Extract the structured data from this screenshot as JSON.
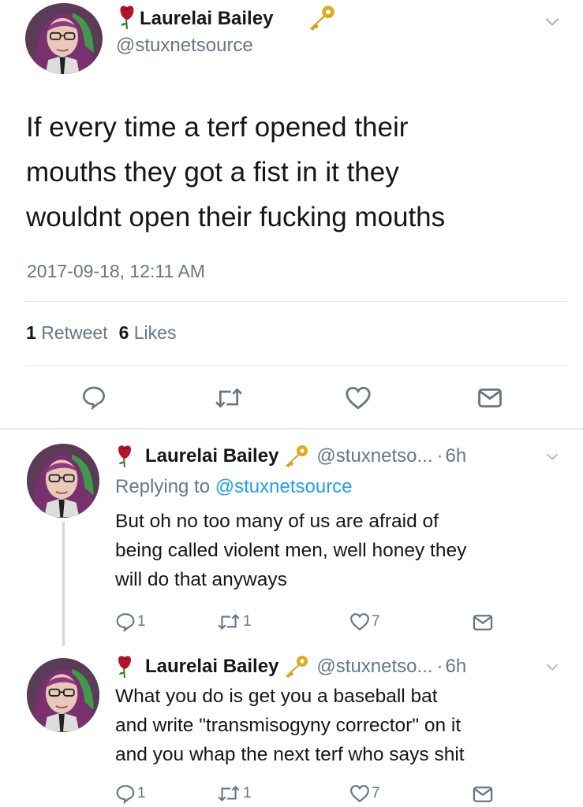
{
  "main_tweet": {
    "display_name": "Laurelai Bailey",
    "handle": "@stuxnetsource",
    "text_lines": [
      "If every time a terf opened their",
      "mouths they got a fist in it they",
      "wouldnt open their fucking mouths"
    ],
    "timestamp": "2017-09-18, 12:11 AM",
    "stats": {
      "retweet_count": "1",
      "retweet_label": "Retweet",
      "like_count": "6",
      "like_label": "Likes"
    }
  },
  "replies": [
    {
      "display_name": "Laurelai Bailey",
      "handle": "@stuxnetso...",
      "separator": "·",
      "time": "6h",
      "replying_to_label": "Replying to",
      "replying_to_handle": "@stuxnetsource",
      "text_lines": [
        "But oh no too many of us are afraid of",
        "being called violent men, well honey they",
        "will do that anyways"
      ],
      "reply_count": "1",
      "retweet_count": "1",
      "like_count": "7"
    },
    {
      "display_name": "Laurelai Bailey",
      "handle": "@stuxnetso...",
      "separator": "·",
      "time": "6h",
      "text_lines": [
        "What you do is get you a baseball bat",
        "and write \"transmisogyny corrector\" on it",
        "and you whap the next terf who says shit"
      ],
      "reply_count": "1",
      "retweet_count": "1",
      "like_count": "7"
    }
  ],
  "icons": {
    "name_prefix": "rose-icon",
    "verified_suffix": "key-icon",
    "reply": "reply-icon",
    "retweet": "retweet-icon",
    "like": "heart-icon",
    "dm": "envelope-icon",
    "caret": "chevron-down-icon"
  },
  "colors": {
    "text": "#14171a",
    "muted": "#657786",
    "divider": "#e1e8ed",
    "rose": "#b3142a",
    "key": "#d7a21b"
  }
}
